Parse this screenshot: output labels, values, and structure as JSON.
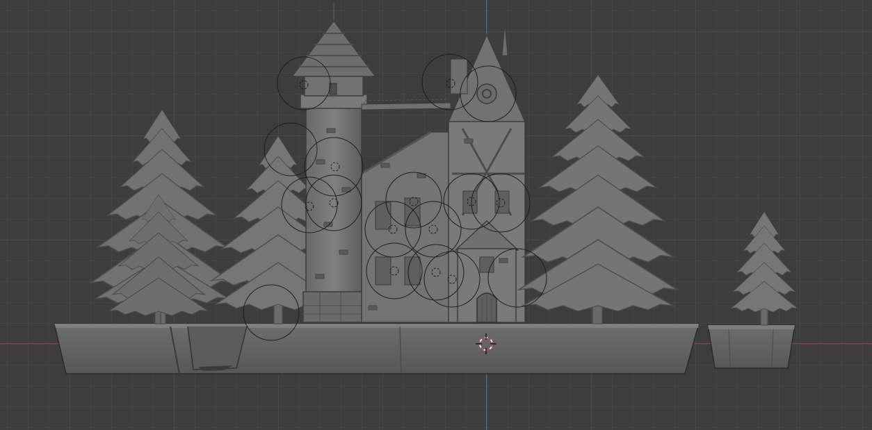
{
  "viewport": {
    "mode": "orthographic-front",
    "colors": {
      "background": "#3d3d3d",
      "grid_minor": "#444444",
      "grid_major": "#484848",
      "x_axis": "#9c3b3b",
      "z_axis": "#3f6fb0",
      "mesh": "#7c7c7c",
      "mesh_shadow": "#5a5a5a",
      "mesh_highlight": "#9a9a9a",
      "outline": "#1c1c1c",
      "cursor_red": "#e04040",
      "cursor_white": "#f2f2f2"
    },
    "objects": [
      "wizard-tower",
      "timber-house",
      "pine-tree-left-large",
      "pine-tree-left-small",
      "pine-tree-center-left",
      "pine-tree-right-large",
      "pine-tree-far-right",
      "terrain-base",
      "planter-base",
      "light-probe-circles"
    ],
    "cursor": "3d-cursor-icon"
  }
}
